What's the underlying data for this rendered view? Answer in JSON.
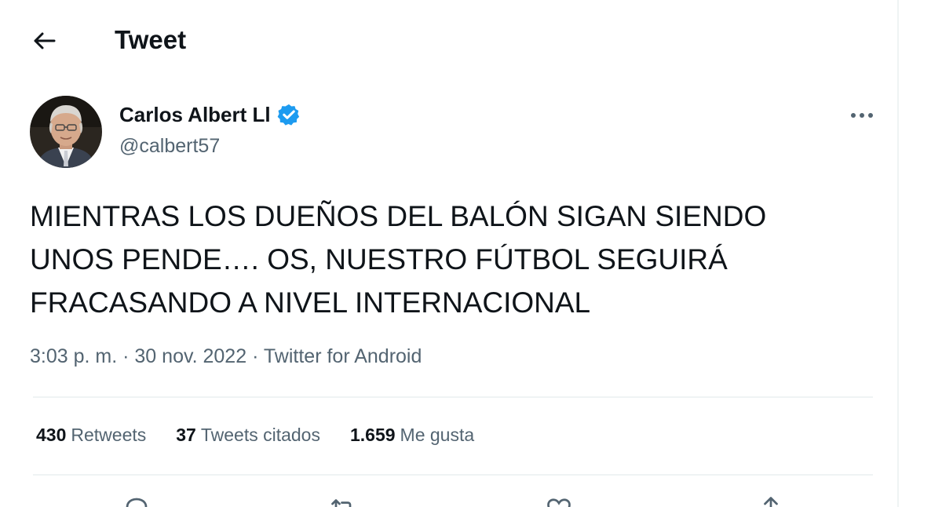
{
  "header": {
    "title": "Tweet",
    "back_icon": "arrow-left-icon"
  },
  "author": {
    "name": "Carlos Albert Ll",
    "handle": "@calbert57",
    "verified_icon": "verified-badge-icon",
    "verified_color": "#1d9bf0"
  },
  "more_icon": "more-horizontal-icon",
  "tweet": {
    "text_lines": [
      "MIENTRAS LOS DUEÑOS DEL BALÓN SIGAN SIENDO",
      "UNOS PENDE…. OS, NUESTRO FÚTBOL SEGUIRÁ",
      "FRACASANDO A NIVEL INTERNACIONAL"
    ]
  },
  "meta": {
    "time": "3:03 p. m.",
    "separator": "·",
    "date": "30 nov. 2022",
    "source": "Twitter for Android"
  },
  "stats": [
    {
      "count": "430",
      "label": "Retweets"
    },
    {
      "count": "37",
      "label": "Tweets citados"
    },
    {
      "count": "1.659",
      "label": "Me gusta"
    }
  ],
  "actions": [
    {
      "icon": "reply-icon"
    },
    {
      "icon": "retweet-icon"
    },
    {
      "icon": "like-icon"
    },
    {
      "icon": "share-icon"
    }
  ],
  "colors": {
    "text": "#0f1419",
    "secondary": "#536471",
    "divider": "#eff3f4"
  }
}
